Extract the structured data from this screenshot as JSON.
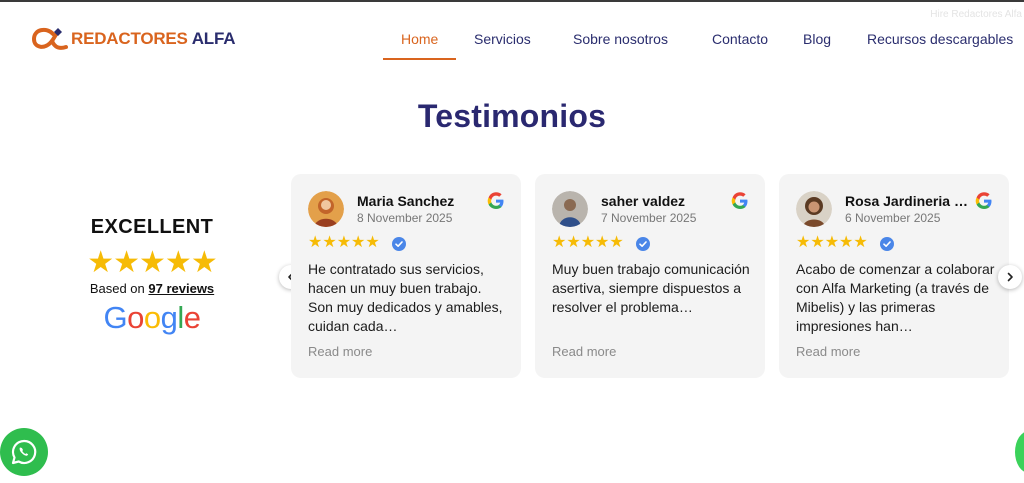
{
  "page": {
    "corner_text": "Hire Redactores Alfa",
    "colors": {
      "accent": "#d9641e",
      "brand_navy": "#2a2d6e",
      "star": "#f6bb06",
      "whatsapp": "#2fbd4e"
    }
  },
  "header": {
    "logo_word1": "REDACTORES",
    "logo_word2": "ALFA",
    "nav": [
      {
        "label": "Home",
        "active": true
      },
      {
        "label": "Servicios",
        "active": false
      },
      {
        "label": "Sobre nosotros",
        "active": false
      },
      {
        "label": "Contacto",
        "active": false
      },
      {
        "label": "Blog",
        "active": false
      },
      {
        "label": "Recursos descargables",
        "active": false
      }
    ]
  },
  "testimonials": {
    "title": "Testimonios",
    "summary": {
      "rating_label": "EXCELLENT",
      "stars": 5,
      "based_on": "Based on",
      "reviews_count": "97 reviews",
      "provider": "Google"
    },
    "cards": [
      {
        "name": "Maria Sanchez",
        "date": "8 November 2025",
        "stars": 5,
        "text": "He contratado sus servicios, hacen un muy buen trabajo. Son muy dedicados y amables, cuidan cada…",
        "read_more": "Read more",
        "avatar_color": "#d98a2e"
      },
      {
        "name": "saher valdez",
        "date": "7 November 2025",
        "stars": 5,
        "text": "Muy buen trabajo comunicación asertiva, siempre dispuestos a resolver el problema…",
        "read_more": "Read more",
        "avatar_color": "#6b86a8"
      },
      {
        "name": "Rosa Jardineria …",
        "date": "6 November 2025",
        "stars": 5,
        "text": "Acabo de comenzar a colaborar con Alfa Marketing (a través de Mibelis) y las primeras impresiones han…",
        "read_more": "Read more",
        "avatar_color": "#a1734c"
      }
    ]
  }
}
